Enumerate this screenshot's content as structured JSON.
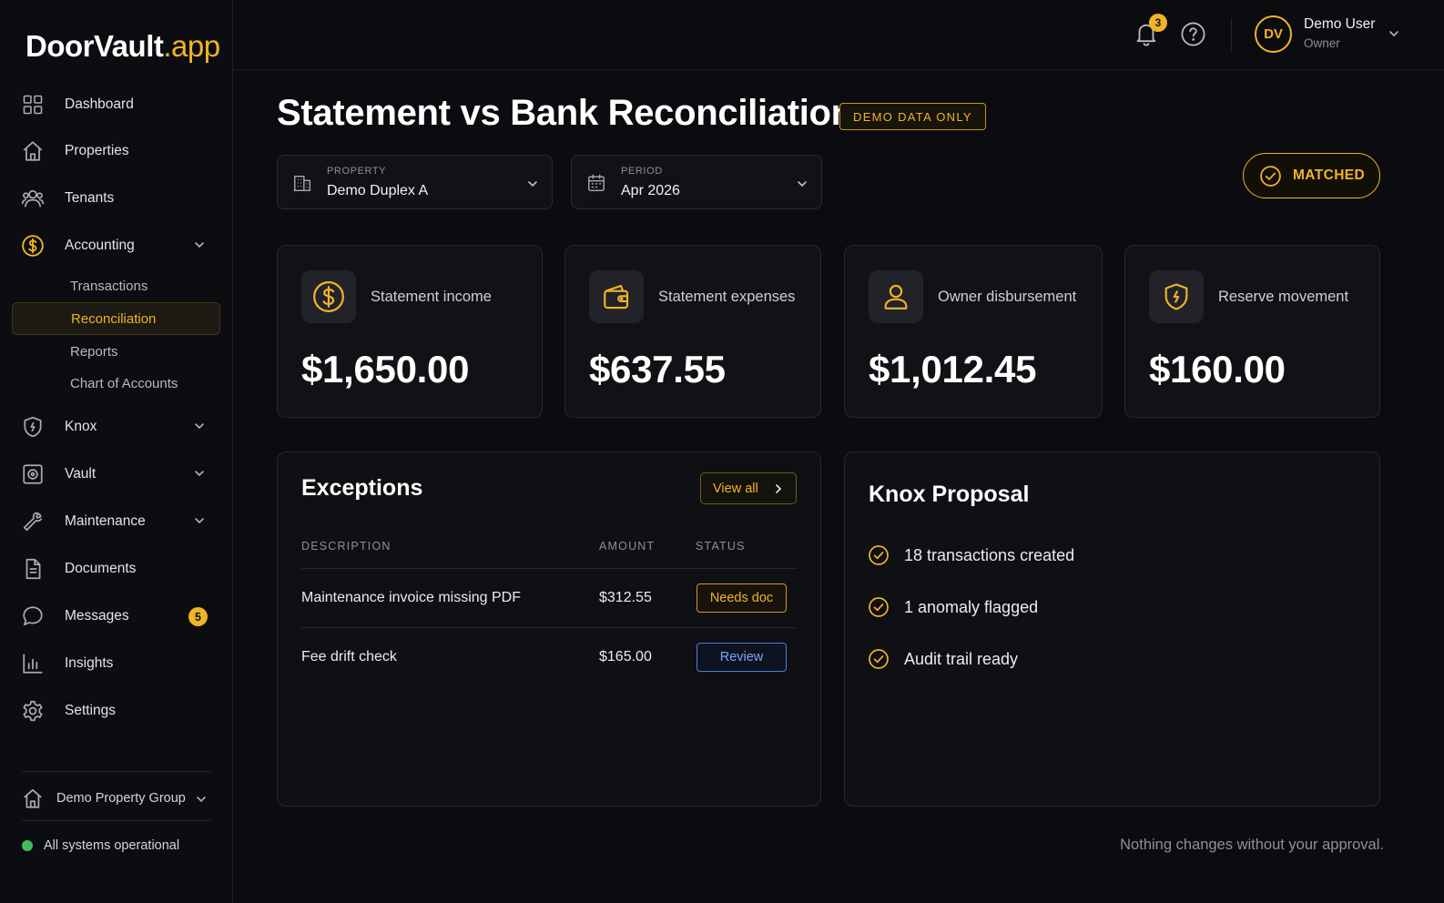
{
  "brand": {
    "name": "DoorVault",
    "suffix": ".app"
  },
  "colors": {
    "accent": "#f0b429",
    "status_ok": "#3fbf5a",
    "review": "#4f7ed6",
    "background": "#0b0c0f"
  },
  "sidebar": {
    "items": [
      {
        "label": "Dashboard",
        "icon": "grid-icon"
      },
      {
        "label": "Properties",
        "icon": "home-icon"
      },
      {
        "label": "Tenants",
        "icon": "users-icon"
      },
      {
        "label": "Accounting",
        "icon": "dollar-icon",
        "expanded": true
      },
      {
        "label": "Knox",
        "icon": "shield-icon"
      },
      {
        "label": "Vault",
        "icon": "safe-icon"
      },
      {
        "label": "Maintenance",
        "icon": "wrench-icon"
      },
      {
        "label": "Documents",
        "icon": "document-icon"
      },
      {
        "label": "Messages",
        "icon": "chat-icon",
        "badge": "5"
      },
      {
        "label": "Insights",
        "icon": "bar-chart-icon"
      },
      {
        "label": "Settings",
        "icon": "gear-icon"
      }
    ],
    "accounting_sub": [
      {
        "label": "Transactions"
      },
      {
        "label": "Reconciliation",
        "active": true
      },
      {
        "label": "Reports"
      },
      {
        "label": "Chart of Accounts"
      }
    ],
    "group": "Demo Property Group",
    "status": "All systems operational"
  },
  "topbar": {
    "notifications_count": "3",
    "user": {
      "initials": "DV",
      "name": "Demo User",
      "role": "Owner"
    }
  },
  "page": {
    "title": "Statement vs Bank Reconciliation",
    "demo_badge": "DEMO DATA ONLY",
    "property": {
      "label": "PROPERTY",
      "value": "Demo Duplex A"
    },
    "period": {
      "label": "PERIOD",
      "value": "Apr 2026"
    },
    "match_status": "MATCHED"
  },
  "stats": [
    {
      "label": "Statement income",
      "value": "$1,650.00",
      "icon": "dollar-icon"
    },
    {
      "label": "Statement expenses",
      "value": "$637.55",
      "icon": "wallet-icon"
    },
    {
      "label": "Owner disbursement",
      "value": "$1,012.45",
      "icon": "user-icon"
    },
    {
      "label": "Reserve movement",
      "value": "$160.00",
      "icon": "shield-icon"
    }
  ],
  "exceptions": {
    "title": "Exceptions",
    "view_all": "View all",
    "columns": [
      "DESCRIPTION",
      "AMOUNT",
      "STATUS"
    ],
    "rows": [
      {
        "description": "Maintenance invoice missing PDF",
        "amount": "$312.55",
        "status": "Needs doc"
      },
      {
        "description": "Fee drift check",
        "amount": "$165.00",
        "status": "Review"
      }
    ]
  },
  "knox": {
    "title": "Knox Proposal",
    "items": [
      "18 transactions created",
      "1 anomaly flagged",
      "Audit trail ready"
    ]
  },
  "footer_note": "Nothing changes without your approval."
}
